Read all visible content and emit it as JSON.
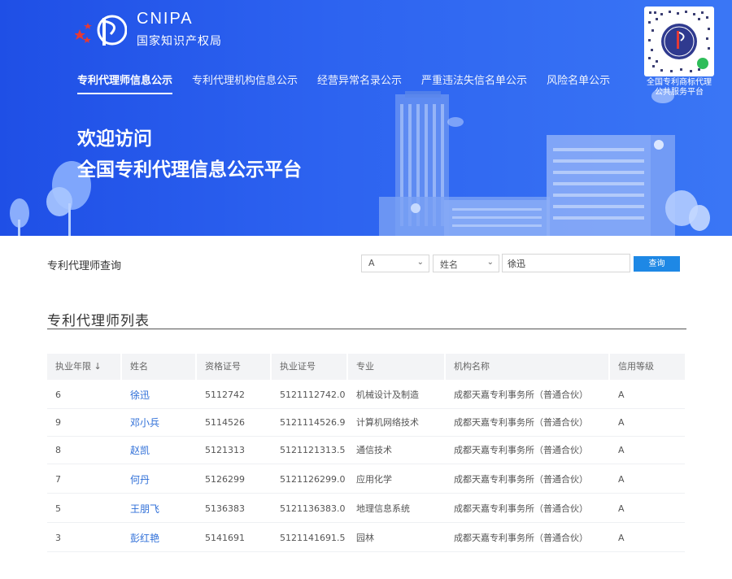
{
  "header": {
    "brand": "CNIPA",
    "subtitle": "国家知识产权局",
    "welcome_line1": "欢迎访问",
    "welcome_line2": "全国专利代理信息公示平台",
    "qr_caption_line1": "全国专利商标代理",
    "qr_caption_line2": "公共服务平台"
  },
  "nav": {
    "items": [
      {
        "label": "专利代理师信息公示",
        "active": true
      },
      {
        "label": "专利代理机构信息公示",
        "active": false
      },
      {
        "label": "经营异常名录公示",
        "active": false
      },
      {
        "label": "严重违法失信名单公示",
        "active": false
      },
      {
        "label": "风险名单公示",
        "active": false
      }
    ]
  },
  "search": {
    "label": "专利代理师查询",
    "select1_value": "A",
    "select2_value": "姓名",
    "input_value": "徐迅",
    "button_label": "查询"
  },
  "list": {
    "title": "专利代理师列表",
    "columns": [
      "执业年限 ↓",
      "姓名",
      "资格证号",
      "执业证号",
      "专业",
      "机构名称",
      "信用等级"
    ],
    "rows": [
      {
        "years": "6",
        "name": "徐迅",
        "cert": "5112742",
        "license": "5121112742.0",
        "major": "机械设计及制造",
        "org": "成都天嘉专利事务所（普通合伙）",
        "credit": "A"
      },
      {
        "years": "9",
        "name": "邓小兵",
        "cert": "5114526",
        "license": "5121114526.9",
        "major": "计算机网络技术",
        "org": "成都天嘉专利事务所（普通合伙）",
        "credit": "A"
      },
      {
        "years": "8",
        "name": "赵凯",
        "cert": "5121313",
        "license": "5121121313.5",
        "major": "通信技术",
        "org": "成都天嘉专利事务所（普通合伙）",
        "credit": "A"
      },
      {
        "years": "7",
        "name": "何丹",
        "cert": "5126299",
        "license": "5121126299.0",
        "major": "应用化学",
        "org": "成都天嘉专利事务所（普通合伙）",
        "credit": "A"
      },
      {
        "years": "5",
        "name": "王朋飞",
        "cert": "5136383",
        "license": "5121136383.0",
        "major": "地理信息系统",
        "org": "成都天嘉专利事务所（普通合伙）",
        "credit": "A"
      },
      {
        "years": "3",
        "name": "彭红艳",
        "cert": "5141691",
        "license": "5121141691.5",
        "major": "园林",
        "org": "成都天嘉专利事务所（普通合伙）",
        "credit": "A"
      }
    ]
  },
  "colors": {
    "hero_blue": "#2d63f0",
    "button_blue": "#1e88e5",
    "link_blue": "#2f6fd8",
    "emblem_red": "#e53935"
  },
  "icons": {
    "emblem": "cnipa-emblem-icon",
    "qr": "qr-code-icon",
    "select": "chevron-down-icon",
    "sort": "sort-arrow-icon"
  }
}
